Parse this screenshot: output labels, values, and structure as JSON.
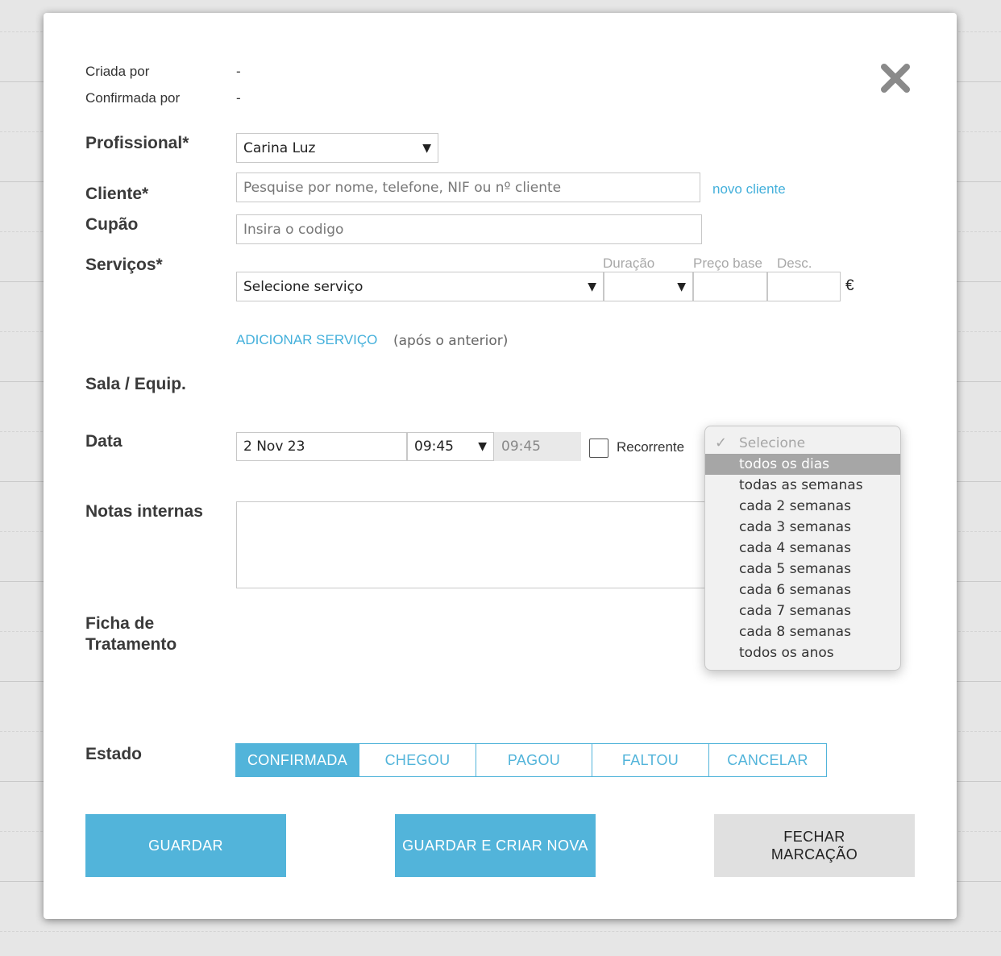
{
  "meta": {
    "created_by_label": "Criada por",
    "created_by_value": "-",
    "confirmed_by_label": "Confirmada por",
    "confirmed_by_value": "-"
  },
  "close_icon": "close-x-icon",
  "professional": {
    "label": "Profissional*",
    "value": "Carina Luz"
  },
  "client": {
    "label": "Cliente*",
    "placeholder": "Pesquise por nome, telefone, NIF ou nº cliente",
    "new_link": "novo cliente"
  },
  "coupon": {
    "label": "Cupão",
    "placeholder": "Insira o codigo"
  },
  "services": {
    "label": "Serviços*",
    "select_value": "Selecione serviço",
    "duration_label": "Duração",
    "price_label": "Preço base",
    "discount_label": "Desc.",
    "currency": "€",
    "add_link": "ADICIONAR SERVIÇO",
    "add_note": "(após o anterior)"
  },
  "room": {
    "label": "Sala / Equip."
  },
  "date": {
    "label": "Data",
    "value": "2 Nov 23",
    "start_time": "09:45",
    "end_time": "09:45",
    "recurring_label": "Recorrente",
    "recurring_checked": false
  },
  "recurrence_dropdown": {
    "placeholder": "Selecione",
    "selected_index": 0,
    "options": [
      "todos os dias",
      "todas as semanas",
      "cada 2 semanas",
      "cada 3 semanas",
      "cada 4 semanas",
      "cada 5 semanas",
      "cada 6 semanas",
      "cada 7 semanas",
      "cada 8 semanas",
      "todos os anos"
    ]
  },
  "notes": {
    "label": "Notas internas",
    "value": ""
  },
  "treatment": {
    "label_line1": "Ficha de",
    "label_line2": "Tratamento"
  },
  "status": {
    "label": "Estado",
    "options": [
      "CONFIRMADA",
      "CHEGOU",
      "PAGOU",
      "FALTOU",
      "CANCELAR"
    ],
    "active": "CONFIRMADA"
  },
  "actions": {
    "save": "GUARDAR",
    "save_new": "GUARDAR E CRIAR NOVA",
    "close_line1": "FECHAR",
    "close_line2": "MARCAÇÃO"
  },
  "colors": {
    "accent": "#52b4da",
    "link": "#44b0db",
    "grey_button": "#e0e0e0",
    "dropdown_selected": "#a6a6a6"
  }
}
